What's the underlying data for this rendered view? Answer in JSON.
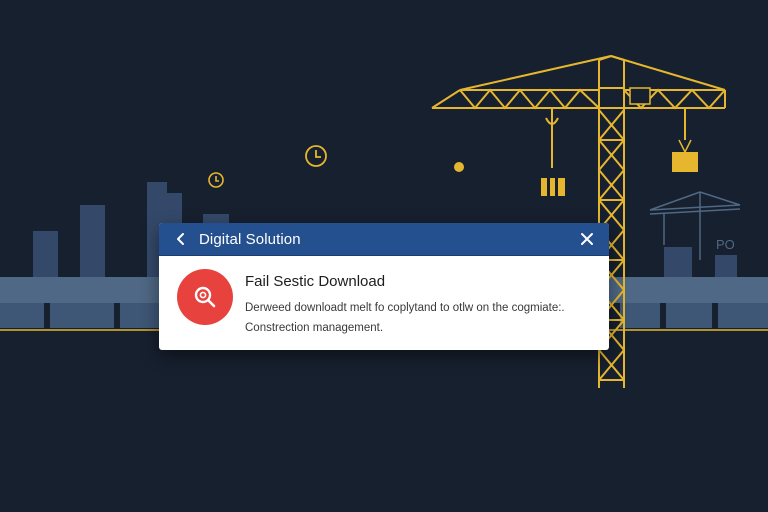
{
  "dialog": {
    "title": "Digital Solution",
    "message_title": "Fail Sestic Download",
    "message_line1": "Derweed downloadt melt fo coplytand to otlw on the cogmiate:.",
    "message_line2": "Constrection management."
  },
  "background": {
    "sign_text": "PO"
  },
  "colors": {
    "background": "#17202f",
    "header": "#24508f",
    "error": "#e8423f",
    "crane": "#e6b72e",
    "skyline": "#34496a"
  },
  "icons": [
    "back-chevron-icon",
    "close-icon",
    "search-error-icon",
    "clock-icon",
    "crane-icon"
  ]
}
